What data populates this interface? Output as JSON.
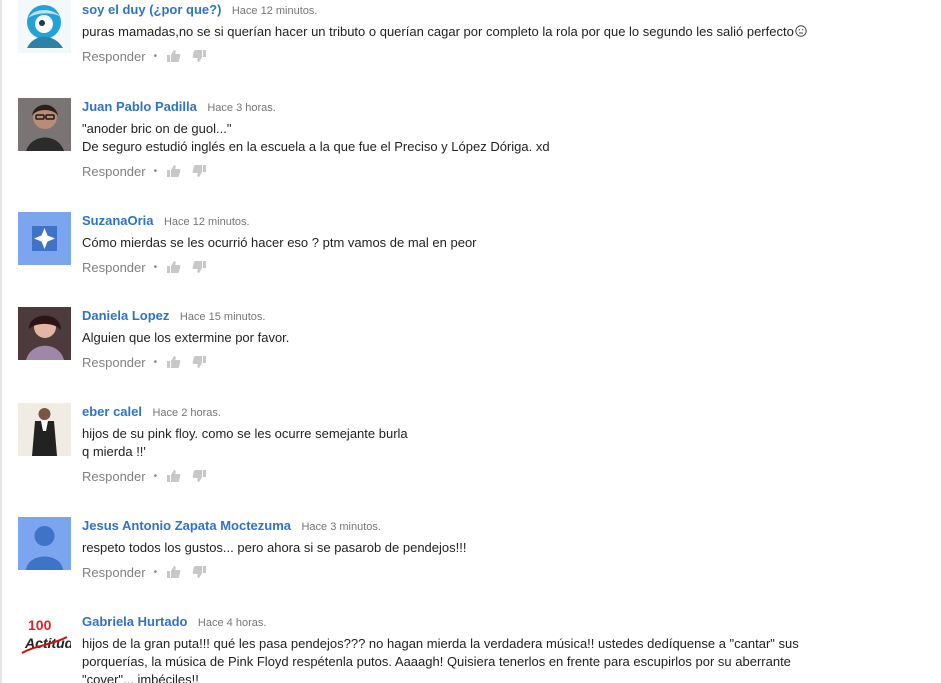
{
  "comments": [
    {
      "author": "soy el duy (¿por que?)",
      "time": "Hace 12 minutos.",
      "lines": [
        "puras mamadas,no se si querían hacer un tributo o querían cagar por completo la rola por que lo segundo les salió perfecto"
      ],
      "emoji": "neutral-face-emoji",
      "reply_label": "Responder",
      "avatar": "cartoon-avatar"
    },
    {
      "author": "Juan Pablo Padilla",
      "time": "Hace 3 horas.",
      "lines": [
        "\"anoder bric on de guol...\"",
        "De seguro estudió inglés en la escuela a la que fue el Preciso y López Dóriga. xd"
      ],
      "reply_label": "Responder",
      "avatar": "photo-avatar"
    },
    {
      "author": "SuzanaOria",
      "time": "Hace 12 minutos.",
      "lines": [
        "Cómo mierdas  se les ocurrió hacer eso ? ptm vamos de mal en peor"
      ],
      "reply_label": "Responder",
      "avatar": "default-blue-avatar"
    },
    {
      "author": "Daniela Lopez",
      "time": "Hace 15 minutos.",
      "lines": [
        "Alguien que los extermine por favor."
      ],
      "reply_label": "Responder",
      "avatar": "photo-avatar"
    },
    {
      "author": "eber calel",
      "time": "Hace 2 horas.",
      "lines": [
        "hijos de su pink floy. como se les ocurre semejante burla",
        "q mierda !!'"
      ],
      "reply_label": "Responder",
      "avatar": "photo-avatar"
    },
    {
      "author": "Jesus Antonio Zapata Moctezuma",
      "time": "Hace 3 minutos.",
      "lines": [
        "respeto todos los gustos...  pero ahora si se pasarob de pendejos!!!"
      ],
      "reply_label": "Responder",
      "avatar": "default-person-avatar"
    },
    {
      "author": "Gabriela Hurtado",
      "time": "Hace 4 horas.",
      "lines": [
        "hijos de la gran puta!!! qué les pasa pendejos??? no hagan mierda la verdadera música!! ustedes dedíquense a \"cantar\" sus",
        "porquerías, la música de Pink Floyd respétenla putos. Aaaagh! Quisiera tenerlos en frente para escupirlos por su aberrante",
        "\"cover\"... imbéciles!!"
      ],
      "avatar": "logo-avatar",
      "avatar_text": "100% Actitud"
    }
  ],
  "icons": {
    "like": "thumbs-up-icon",
    "dislike": "thumbs-down-icon"
  },
  "colors": {
    "author": "#2f73c7",
    "meta": "#767676",
    "text": "#222222",
    "action": "#808080",
    "avatar_blue": "#7ca5f0",
    "avatar_white": "#ffffff"
  }
}
